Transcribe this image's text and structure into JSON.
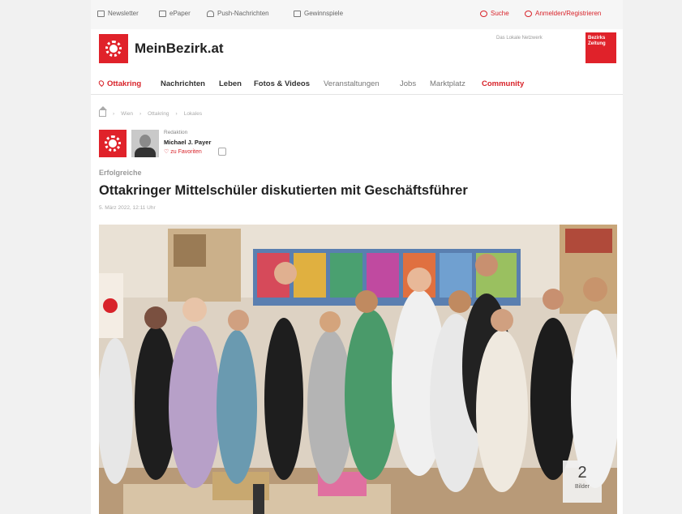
{
  "topbar": {
    "newsletter": "Newsletter",
    "epaper": "ePaper",
    "push": "Push-Nachrichten",
    "gewinnspiele": "Gewinnspiele",
    "search": "Suche",
    "login": "Anmelden/Registrieren"
  },
  "header": {
    "site_name": "MeinBezirk.at",
    "tagline": "Das Lokale Netzwerk",
    "badge": "Bezirks Zeitung"
  },
  "nav": {
    "location": "Ottakring",
    "items": [
      "Nachrichten",
      "Leben",
      "Fotos & Videos",
      "Veranstaltungen",
      "Jobs",
      "Marktplatz"
    ],
    "community": "Community"
  },
  "breadcrumb": [
    "Wien",
    "Ottakring",
    "Lokales"
  ],
  "author": {
    "role": "Redaktion",
    "name": "Michael J. Payer",
    "follow": "zu Favoriten"
  },
  "article": {
    "category": "Erfolgreiche",
    "title": "Ottakringer Mittelschüler diskutierten mit Geschäftsführer",
    "date": "5. März 2022, 12:11 Uhr"
  },
  "gallery": {
    "count": "2",
    "label": "Bilder"
  },
  "colors": {
    "brand_red": "#e0222a",
    "page_bg": "#f1f1f1"
  },
  "icons": [
    "newsletter-icon",
    "epaper-icon",
    "bell-icon",
    "gift-icon",
    "search-icon",
    "user-icon",
    "pin-icon",
    "home-icon"
  ]
}
